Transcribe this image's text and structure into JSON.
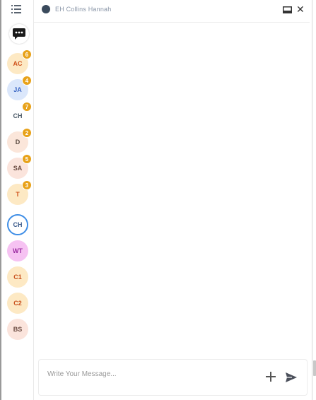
{
  "header": {
    "title": "EH Collins Hannah"
  },
  "composer": {
    "placeholder": "Write Your Message..."
  },
  "contacts": [
    {
      "initials": "AC",
      "badge": "6",
      "bg": "#fde9c4",
      "fg": "#d0541d"
    },
    {
      "initials": "JA",
      "badge": "4",
      "bg": "#dbe7fb",
      "fg": "#3a66c4"
    },
    {
      "initials": "CH",
      "badge": "7",
      "bg": "#ffffff",
      "fg": "#4a5866"
    },
    {
      "initials": "D",
      "badge": "2",
      "bg": "#fbe6da",
      "fg": "#5a4a40"
    },
    {
      "initials": "SA",
      "badge": "5",
      "bg": "#fbe4dc",
      "fg": "#6a4a40"
    },
    {
      "initials": "T",
      "badge": "3",
      "bg": "#fde9c4",
      "fg": "#d0541d"
    },
    {
      "initials": "CH",
      "badge": "",
      "bg": "#ffffff",
      "fg": "#3a5a8a",
      "ring": "#3f8ee6"
    },
    {
      "initials": "WT",
      "badge": "",
      "bg": "#f6c2f2",
      "fg": "#9a2aa0"
    },
    {
      "initials": "C1",
      "badge": "",
      "bg": "#fde9c4",
      "fg": "#c8501c"
    },
    {
      "initials": "C2",
      "badge": "",
      "bg": "#fde9c4",
      "fg": "#c8501c"
    },
    {
      "initials": "BS",
      "badge": "",
      "bg": "#fbe4dc",
      "fg": "#6a4a40"
    }
  ],
  "icons": {
    "menu": "list-icon",
    "logo": "chat-bubble-icon",
    "minimize": "window-icon",
    "close": "close-icon",
    "add": "plus-icon",
    "send": "send-icon"
  },
  "colors": {
    "badge": "#e8a21a",
    "send": "#4a4f5a"
  }
}
